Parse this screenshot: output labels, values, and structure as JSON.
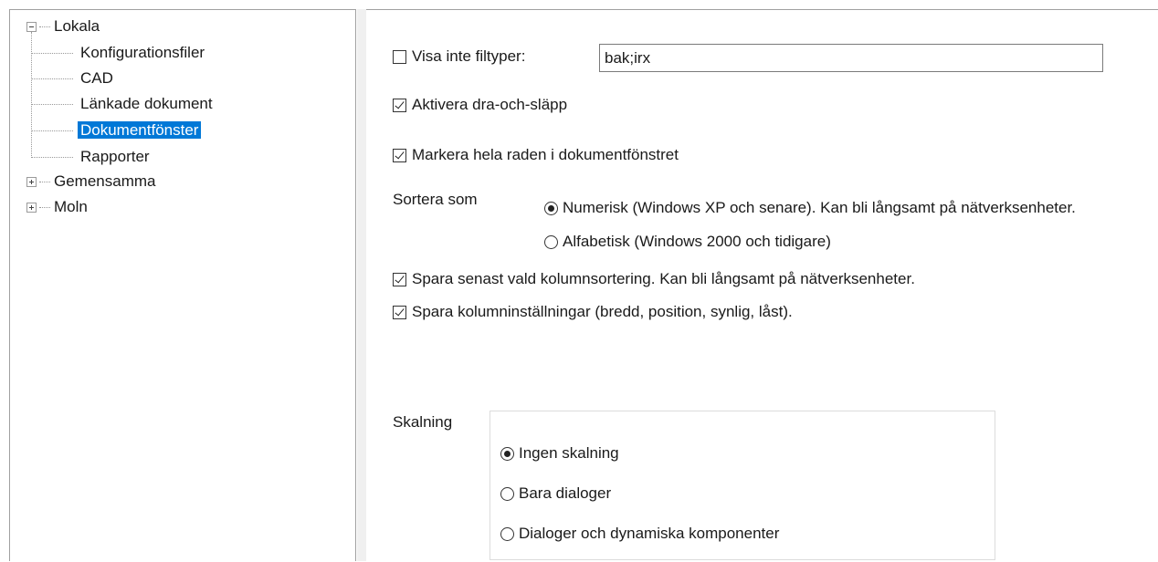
{
  "tree": {
    "items": [
      {
        "label": "Lokala",
        "expanded": true
      },
      {
        "label": "Konfigurationsfiler"
      },
      {
        "label": "CAD"
      },
      {
        "label": "Länkade dokument"
      },
      {
        "label": "Dokumentfönster",
        "selected": true
      },
      {
        "label": "Rapporter"
      },
      {
        "label": "Gemensamma",
        "expanded": false
      },
      {
        "label": "Moln",
        "expanded": false
      }
    ]
  },
  "options": {
    "hide_filetypes": {
      "label": "Visa inte filtyper:",
      "checked": false,
      "value": "bak;irx"
    },
    "drag_drop": {
      "label": "Aktivera dra-och-släpp",
      "checked": true
    },
    "highlight_row": {
      "label": "Markera hela raden i dokumentfönstret",
      "checked": true
    },
    "sort": {
      "label": "Sortera som",
      "options": [
        {
          "label": "Numerisk (Windows XP och senare). Kan bli långsamt på nätverksenheter.",
          "selected": true
        },
        {
          "label": "Alfabetisk (Windows 2000 och tidigare)",
          "selected": false
        }
      ]
    },
    "save_sort": {
      "label": "Spara senast vald kolumnsortering. Kan bli långsamt på nätverksenheter.",
      "checked": true
    },
    "save_columns": {
      "label": "Spara kolumninställningar (bredd, position, synlig, låst).",
      "checked": true
    },
    "scaling": {
      "label": "Skalning",
      "options": [
        {
          "label": "Ingen skalning",
          "selected": true
        },
        {
          "label": "Bara dialoger",
          "selected": false
        },
        {
          "label": "Dialoger och dynamiska komponenter",
          "selected": false
        }
      ]
    }
  }
}
